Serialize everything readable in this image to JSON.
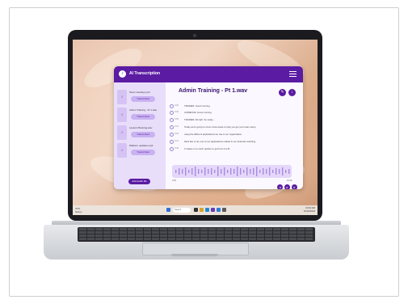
{
  "app": {
    "title": "AI Transcription",
    "logo_glyph": "♪"
  },
  "sidebar": {
    "items": [
      {
        "name": "Team meeting.mp4",
        "button": "Transcribed"
      },
      {
        "name": "Admin Training - Pt 1.wav",
        "button": "Transcribed"
      },
      {
        "name": "Lesson Planning.wav",
        "button": "Transcribed"
      },
      {
        "name": "Platform updates.mp4",
        "button": "Transcribed"
      }
    ],
    "add_button": "Add audio file"
  },
  "main": {
    "title": "Admin Training - Pt 1.wav",
    "lines": [
      {
        "time": "0:00",
        "text": "TRAINER: Good morning."
      },
      {
        "time": "0:03",
        "text": "AUDIENCE: Good morning."
      },
      {
        "time": "0:05",
        "text": "TRAINER: All right. So today..."
      },
      {
        "time": "0:12",
        "text": "Today we're going to cover a few areas to help you get your team setup"
      },
      {
        "time": "0:20",
        "text": "using the different applications we use in our organization."
      },
      {
        "time": "0:31",
        "text": "We'd like to do a lot of our applications related to our financial matching."
      },
      {
        "time": "0:45",
        "text": "It makes it so much quicker to get from A to B."
      }
    ],
    "time_start": "0:00",
    "time_end": "13:45"
  },
  "taskbar": {
    "weather": "70°F",
    "weather_sub": "Sunny",
    "search_placeholder": "Search",
    "time": "10:10 AM",
    "date": "10/16/2024"
  },
  "colors": {
    "accent": "#5b1ba2",
    "sidebar_bg": "#e8defa"
  }
}
